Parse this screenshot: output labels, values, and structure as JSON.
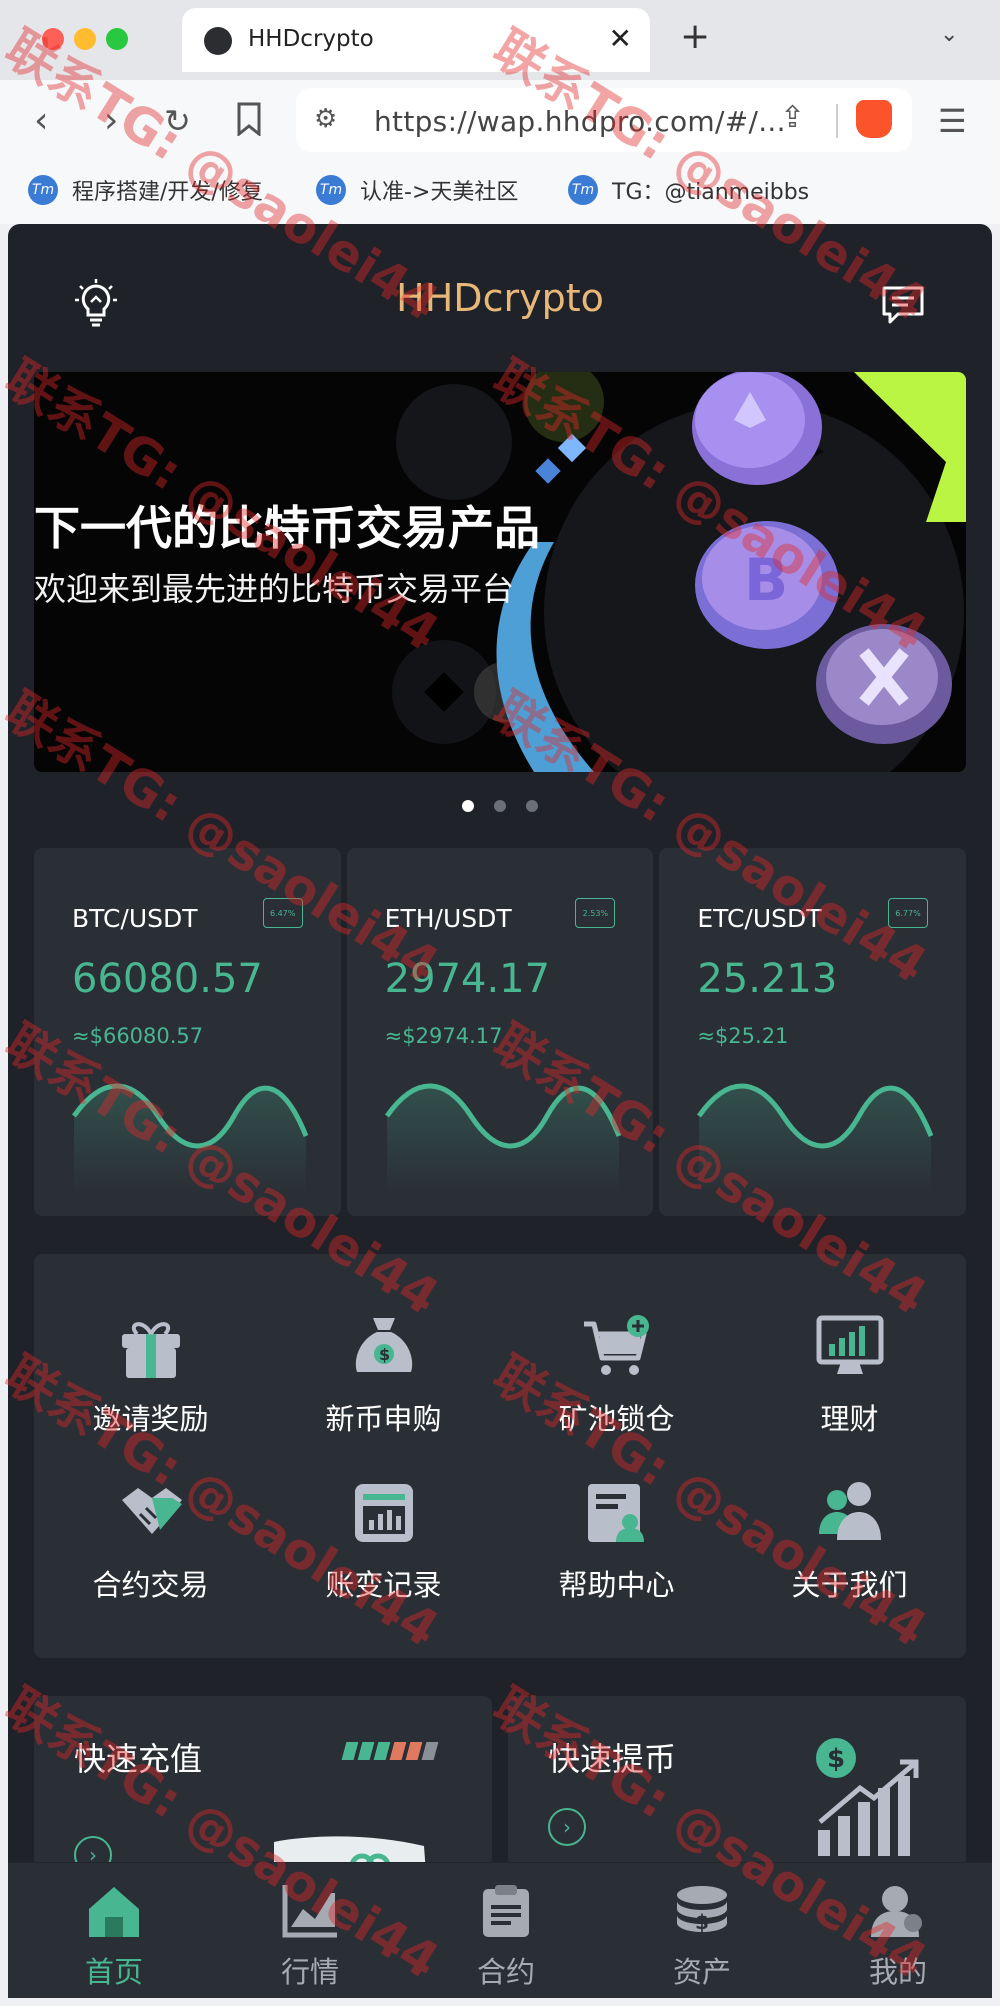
{
  "browser": {
    "tab_title": "HHDcrypto",
    "tab_close": "✕",
    "new_tab": "+",
    "tab_list": "⌄",
    "url": "https://wap.hhdpro.com/#/...",
    "bookmarks": [
      {
        "icon": "Tm",
        "label": "程序搭建/开发/修复"
      },
      {
        "icon": "Tm",
        "label": "认准->天美社区"
      },
      {
        "icon": "Tm",
        "label": "TG：@tianmeibbs"
      }
    ]
  },
  "app": {
    "title": "HHDcrypto",
    "banner": {
      "headline": "下一代的比特币交易产品",
      "subline": "欢迎来到最先进的比特币交易平台"
    },
    "carousel_active": 0,
    "tickers": [
      {
        "pair": "BTC/USDT",
        "change": "6.47%",
        "price": "66080.57",
        "usd": "≈$66080.57"
      },
      {
        "pair": "ETH/USDT",
        "change": "2.53%",
        "price": "2974.17",
        "usd": "≈$2974.17"
      },
      {
        "pair": "ETC/USDT",
        "change": "6.77%",
        "price": "25.213",
        "usd": "≈$25.21"
      }
    ],
    "grid": [
      {
        "label": "邀请奖励",
        "icon": "gift-icon"
      },
      {
        "label": "新币申购",
        "icon": "money-bag-icon"
      },
      {
        "label": "矿池锁仓",
        "icon": "cart-add-icon"
      },
      {
        "label": "理财",
        "icon": "monitor-chart-icon"
      },
      {
        "label": "合约交易",
        "icon": "handshake-icon"
      },
      {
        "label": "账变记录",
        "icon": "bar-report-icon"
      },
      {
        "label": "帮助中心",
        "icon": "help-doc-icon"
      },
      {
        "label": "关于我们",
        "icon": "users-icon"
      }
    ],
    "quick": [
      {
        "title": "快速充值",
        "arrow": "›"
      },
      {
        "title": "快速提币",
        "arrow": "›",
        "badge": "$"
      }
    ],
    "nav": [
      {
        "label": "首页",
        "icon": "home-icon",
        "active": true
      },
      {
        "label": "行情",
        "icon": "market-chart-icon"
      },
      {
        "label": "合约",
        "icon": "clipboard-icon"
      },
      {
        "label": "资产",
        "icon": "coins-icon"
      },
      {
        "label": "我的",
        "icon": "user-icon"
      }
    ]
  },
  "watermark": {
    "text": "联系TG: @saolei44"
  },
  "colors": {
    "accent": "#48b690",
    "brand": "#e8b879",
    "bg": "#1f2228",
    "card": "#2a2e35"
  }
}
